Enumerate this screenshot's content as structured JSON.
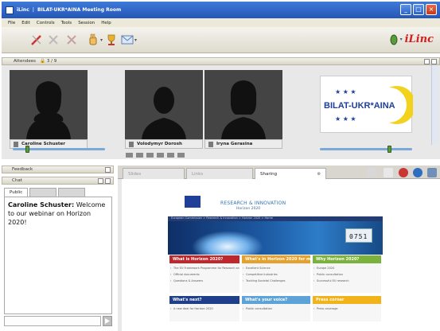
{
  "window": {
    "app_label": "iLinc",
    "title": "BILAT-UKR*AINA Meeting Room",
    "controls": [
      "minimize",
      "maximize",
      "close"
    ]
  },
  "menu": [
    "File",
    "Edit",
    "Controls",
    "Tools",
    "Session",
    "Help"
  ],
  "toolbar": {
    "icons": [
      "pen-icon",
      "delete-icon",
      "clear-icon",
      "raise-hand-icon",
      "award-icon",
      "mail-icon"
    ],
    "brand": "iLinc"
  },
  "attendees": {
    "header": "Attendees",
    "count": "3 / 9",
    "people": [
      {
        "name": "Caroline Schuster"
      },
      {
        "name": "Volodymyr Dorosh"
      },
      {
        "name": "Iryna Gerasina"
      }
    ],
    "logo_text": "BILAT-UKR*AINA"
  },
  "left_panel": {
    "feedback_header": "Feedback",
    "chat_header": "Chat",
    "chat_tabs": [
      "Public",
      "",
      ""
    ],
    "messages": [
      {
        "sender": "Caroline Schuster:",
        "text": "Welcome to our webinar on Horizon 2020!"
      }
    ]
  },
  "content": {
    "tabs": [
      "Slides",
      "Links",
      "Sharing"
    ],
    "shared_page": {
      "title": "RESEARCH & INNOVATION",
      "subtitle": "Horizon 2020",
      "nav": "European Commission > Research & Innovation > Horizon 2020 > Home",
      "counter": "0751",
      "col1_head": "What is Horizon 2020?",
      "col1_items": [
        "The EU Framework Programme for Research and Innovation",
        "Official documents",
        "Questions & Answers"
      ],
      "col2_head": "What's in Horizon 2020 for me?",
      "col2_items": [
        "Excellent Science",
        "Competitive Industries",
        "Tackling Societal Challenges"
      ],
      "col3_head": "Why Horizon 2020?",
      "col3_items": [
        "Europe 2020",
        "Public consultation",
        "Successful EU research"
      ],
      "col4_head": "What's next?",
      "col4_items": [
        "A new deal for Horizon 2020"
      ],
      "col5_head": "What's your voice?",
      "col5_items": [
        "Public consultation"
      ],
      "col6_head": "Press corner",
      "col6_items": [
        "Press coverage"
      ]
    }
  },
  "colors": {
    "titlebar": "#2456b8",
    "brand_red": "#d31f1f",
    "panel_bg": "#ece9d8"
  }
}
